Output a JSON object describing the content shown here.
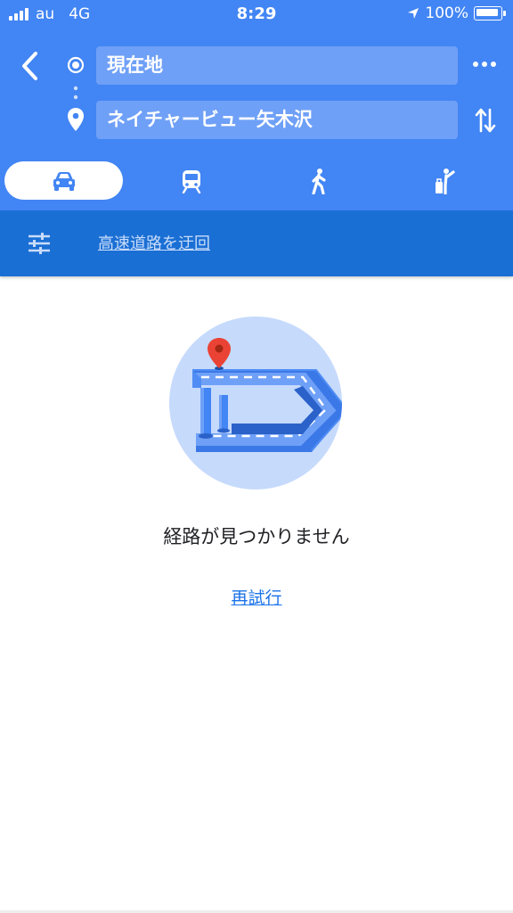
{
  "status_bar": {
    "carrier": "au",
    "network": "4G",
    "time": "8:29",
    "battery": "100%"
  },
  "route": {
    "origin": "現在地",
    "destination": "ネイチャービュー矢木沢"
  },
  "modes": [
    {
      "name": "drive",
      "icon": "car-icon",
      "selected": true
    },
    {
      "name": "transit",
      "icon": "train-icon",
      "selected": false
    },
    {
      "name": "walk",
      "icon": "walk-icon",
      "selected": false
    },
    {
      "name": "ride",
      "icon": "ride-hail-icon",
      "selected": false
    }
  ],
  "options": {
    "link_label": "高速道路を迂回"
  },
  "empty_state": {
    "message": "経路が見つかりません",
    "retry_label": "再試行"
  },
  "colors": {
    "header_blue": "#4285f4",
    "options_bar_blue": "#1a6fd4",
    "field_blue": "#6fa0f7",
    "link_blue": "#1a73e8",
    "pin_red": "#ea4335"
  }
}
